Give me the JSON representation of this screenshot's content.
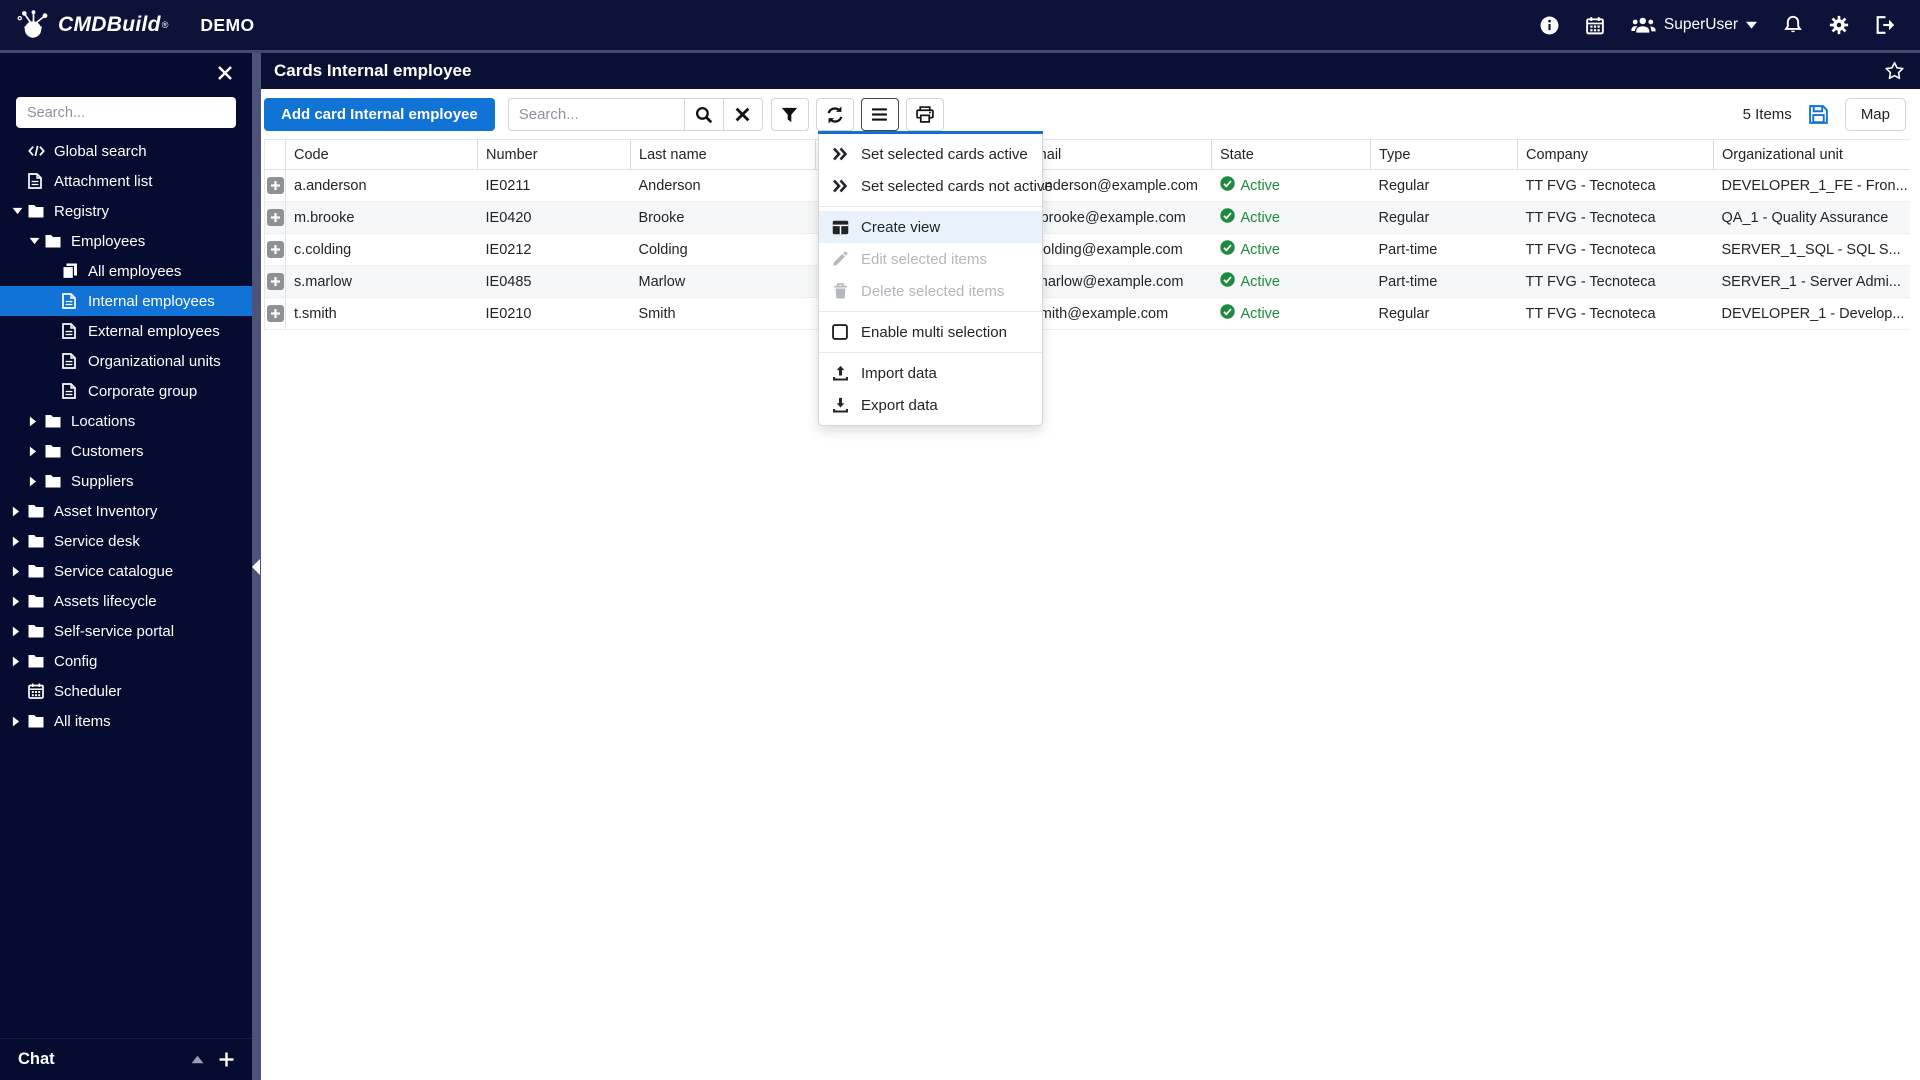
{
  "navbar": {
    "brand": "CMDBuild",
    "registered": "®",
    "environment": "DEMO",
    "user": "SuperUser"
  },
  "sidebar": {
    "search_placeholder": "Search...",
    "chat_label": "Chat",
    "items": [
      {
        "label": "Global search",
        "icon": "code-icon",
        "level": 0,
        "arrow": "none",
        "selected": false
      },
      {
        "label": "Attachment list",
        "icon": "file-icon",
        "level": 0,
        "arrow": "none",
        "selected": false
      },
      {
        "label": "Registry",
        "icon": "folder-icon",
        "level": 0,
        "arrow": "down",
        "selected": false
      },
      {
        "label": "Employees",
        "icon": "folder-icon",
        "level": 1,
        "arrow": "down",
        "selected": false
      },
      {
        "label": "All employees",
        "icon": "copy-icon",
        "level": 2,
        "arrow": "none",
        "selected": false
      },
      {
        "label": "Internal employees",
        "icon": "file-text-icon",
        "level": 2,
        "arrow": "none",
        "selected": true
      },
      {
        "label": "External employees",
        "icon": "file-text-icon",
        "level": 2,
        "arrow": "none",
        "selected": false
      },
      {
        "label": "Organizational units",
        "icon": "file-text-icon",
        "level": 2,
        "arrow": "none",
        "selected": false
      },
      {
        "label": "Corporate group",
        "icon": "file-text-icon",
        "level": 2,
        "arrow": "none",
        "selected": false
      },
      {
        "label": "Locations",
        "icon": "folder-icon",
        "level": 1,
        "arrow": "right",
        "selected": false
      },
      {
        "label": "Customers",
        "icon": "folder-icon",
        "level": 1,
        "arrow": "right",
        "selected": false
      },
      {
        "label": "Suppliers",
        "icon": "folder-icon",
        "level": 1,
        "arrow": "right",
        "selected": false
      },
      {
        "label": "Asset Inventory",
        "icon": "folder-icon",
        "level": 0,
        "arrow": "right",
        "selected": false
      },
      {
        "label": "Service desk",
        "icon": "folder-icon",
        "level": 0,
        "arrow": "right",
        "selected": false
      },
      {
        "label": "Service catalogue",
        "icon": "folder-icon",
        "level": 0,
        "arrow": "right",
        "selected": false
      },
      {
        "label": "Assets lifecycle",
        "icon": "folder-icon",
        "level": 0,
        "arrow": "right",
        "selected": false
      },
      {
        "label": "Self-service portal",
        "icon": "folder-icon",
        "level": 0,
        "arrow": "right",
        "selected": false
      },
      {
        "label": "Config",
        "icon": "folder-icon",
        "level": 0,
        "arrow": "right",
        "selected": false
      },
      {
        "label": "Scheduler",
        "icon": "calendar-icon",
        "level": 0,
        "arrow": "none",
        "selected": false
      },
      {
        "label": "All items",
        "icon": "folder-icon",
        "level": 0,
        "arrow": "right",
        "selected": false
      }
    ]
  },
  "main": {
    "title": "Cards Internal employee",
    "favorite_icon": "star-icon",
    "toolbar": {
      "add_button": "Add card Internal employee",
      "search_placeholder": "Search...",
      "items_count": "5 Items",
      "map_button": "Map"
    },
    "table": {
      "columns": [
        "",
        "Code",
        "Number",
        "Last name",
        "",
        "Email",
        "State",
        "Type",
        "Company",
        "Organizational unit"
      ],
      "rows": [
        {
          "code": "a.anderson",
          "number": "IE0211",
          "last_name": "Anderson",
          "first_name": "",
          "email": "a.anderson@example.com",
          "state": "Active",
          "type": "Regular",
          "company": "TT FVG - Tecnoteca",
          "organizational_unit": "DEVELOPER_1_FE - Fron..."
        },
        {
          "code": "m.brooke",
          "number": "IE0420",
          "last_name": "Brooke",
          "first_name": "",
          "email": "m.brooke@example.com",
          "state": "Active",
          "type": "Regular",
          "company": "TT FVG - Tecnoteca",
          "organizational_unit": "QA_1 - Quality Assurance"
        },
        {
          "code": "c.colding",
          "number": "IE0212",
          "last_name": "Colding",
          "first_name": "",
          "email": "c.colding@example.com",
          "state": "Active",
          "type": "Part-time",
          "company": "TT FVG - Tecnoteca",
          "organizational_unit": "SERVER_1_SQL - SQL S..."
        },
        {
          "code": "s.marlow",
          "number": "IE0485",
          "last_name": "Marlow",
          "first_name": "",
          "email": "s.marlow@example.com",
          "state": "Active",
          "type": "Part-time",
          "company": "TT FVG - Tecnoteca",
          "organizational_unit": "SERVER_1 - Server Admi..."
        },
        {
          "code": "t.smith",
          "number": "IE0210",
          "last_name": "Smith",
          "first_name": "",
          "email": "t.smith@example.com",
          "state": "Active",
          "type": "Regular",
          "company": "TT FVG - Tecnoteca",
          "organizational_unit": "DEVELOPER_1 - Develop..."
        }
      ]
    },
    "context_menu": {
      "items": [
        {
          "label": "Set selected cards active",
          "icon": "double-chevron-right-icon",
          "state": "normal",
          "separator_after": false
        },
        {
          "label": "Set selected cards not active",
          "icon": "double-chevron-right-icon",
          "state": "normal",
          "separator_after": true
        },
        {
          "label": "Create view",
          "icon": "table-grid-icon",
          "state": "highlighted",
          "separator_after": false
        },
        {
          "label": "Edit selected items",
          "icon": "pencil-icon",
          "state": "disabled",
          "separator_after": false
        },
        {
          "label": "Delete selected items",
          "icon": "trash-icon",
          "state": "disabled",
          "separator_after": true
        },
        {
          "label": "Enable multi selection",
          "icon": "checkbox-icon",
          "state": "normal",
          "separator_after": true
        },
        {
          "label": "Import data",
          "icon": "upload-icon",
          "state": "normal",
          "separator_after": false
        },
        {
          "label": "Export data",
          "icon": "download-icon",
          "state": "normal",
          "separator_after": false
        }
      ]
    }
  },
  "colors": {
    "navbar_bg": "#0d1238",
    "sidebar_bg": "#060b30",
    "titlebar_bg": "#0a1034",
    "accent_blue": "#1273d6",
    "active_green": "#1e8a3c",
    "disabled_text": "#b2b8be",
    "stripe_row": "#f6f7f8"
  }
}
